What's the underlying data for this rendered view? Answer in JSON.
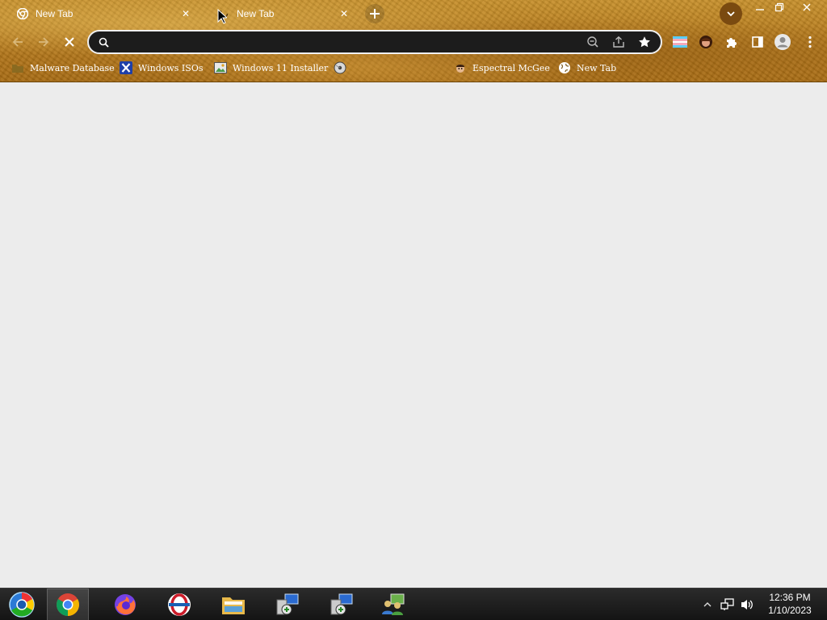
{
  "browser": {
    "tabs": [
      {
        "title": "New Tab",
        "active": true,
        "icon": "chrome-icon"
      },
      {
        "title": "New Tab",
        "active": false,
        "icon": "loading-icon"
      }
    ],
    "window_controls": [
      "minimize",
      "restore",
      "close"
    ],
    "omnibox": {
      "value": "",
      "placeholder": ""
    },
    "bookmarks": [
      {
        "label": "Malware Database",
        "icon": "bookmark-folder-icon"
      },
      {
        "label": "Windows ISOs",
        "icon": "x-logo-icon"
      },
      {
        "label": "Windows 11 Installer",
        "icon": "image-icon"
      },
      {
        "label": "",
        "icon": "disc-icon"
      },
      {
        "label": "Espectral McGee",
        "icon": "character-icon"
      },
      {
        "label": "New Tab",
        "icon": "globe-icon"
      }
    ]
  },
  "taskbar": {
    "apps": [
      "chrome",
      "firefox",
      "opera",
      "file-explorer",
      "installer-1",
      "installer-2",
      "network-app"
    ],
    "clock": {
      "time": "12:36 PM",
      "date": "1/10/2023"
    }
  },
  "colors": {
    "chrome_texture": "#b67a1c",
    "omnibox_bg": "#1c1c1c",
    "page_bg": "#ececec",
    "taskbar_bg": "#1a1a1a"
  }
}
